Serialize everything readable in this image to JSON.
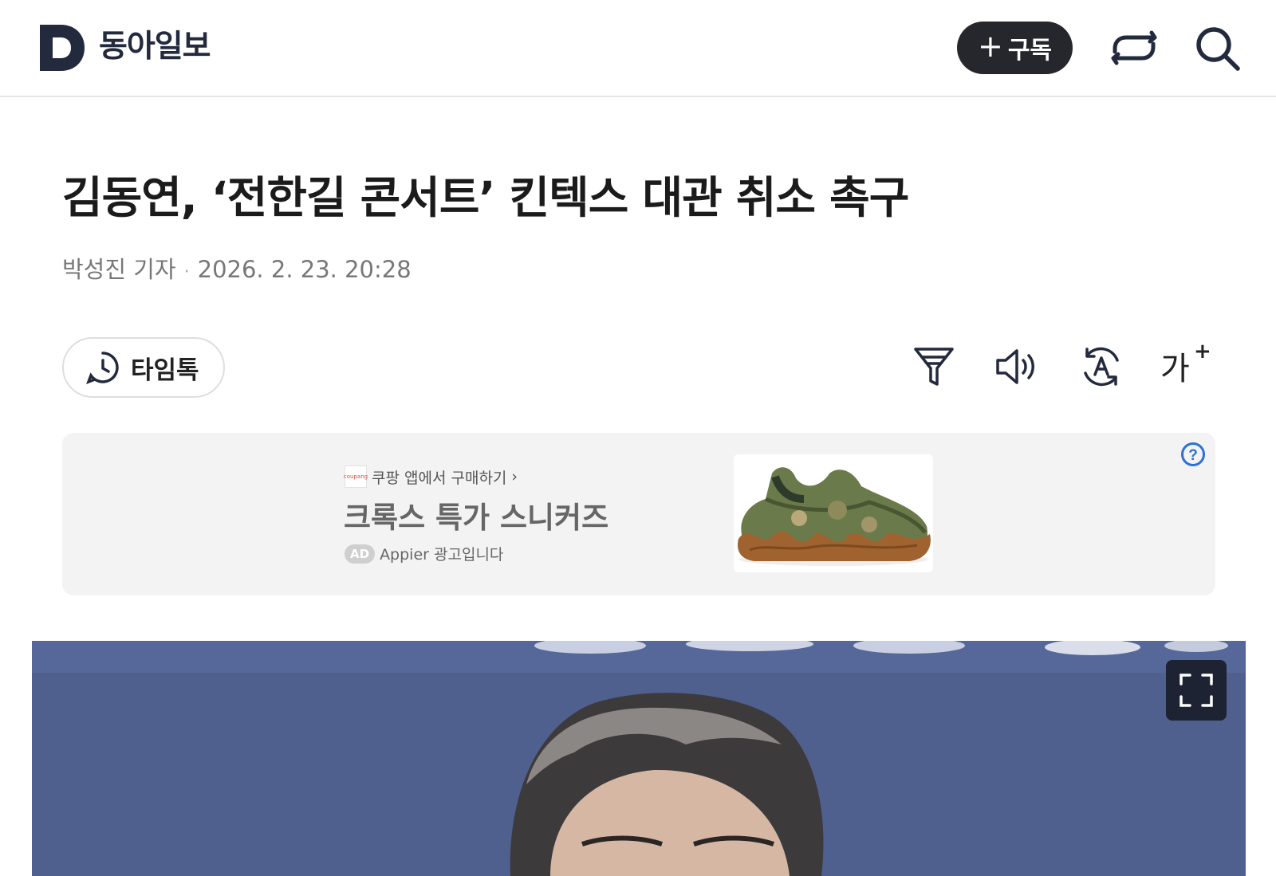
{
  "header": {
    "logo_letter": "D",
    "logo_text": "동아일보",
    "subscribe_plus": "+",
    "subscribe_label": "구독",
    "share_icon": "share-icon",
    "search_icon": "search-icon"
  },
  "article": {
    "headline": "김동연, ‘전한길 콘서트’ 킨텍스 대관 취소 촉구",
    "author": "박성진 기자",
    "separator": "·",
    "datetime": "2026. 2. 23. 20:28"
  },
  "toolbar": {
    "timetalk_label": "타임톡",
    "fontsize_label": "가",
    "fontsize_plus": "+",
    "icons": [
      "timetalk-icon",
      "filter-icon",
      "audio-icon",
      "translate-icon",
      "font-size-icon"
    ]
  },
  "ad": {
    "source_logo": "coupang",
    "source_text": "쿠팡 앱에서 구매하기",
    "source_chevron": "›",
    "title": "크록스 특가 스니커즈",
    "badge": "AD",
    "advertiser": "Appier 광고입니다",
    "help_icon": "question-circle-icon"
  },
  "photo": {
    "expand_icon": "fullscreen-icon"
  },
  "colors": {
    "brand_navy": "#232a3d",
    "subscribe_bg": "#25272d",
    "ad_bg": "#f3f3f3",
    "help_blue": "#2f6fd6",
    "photo_bg": "#4e5f8f"
  }
}
